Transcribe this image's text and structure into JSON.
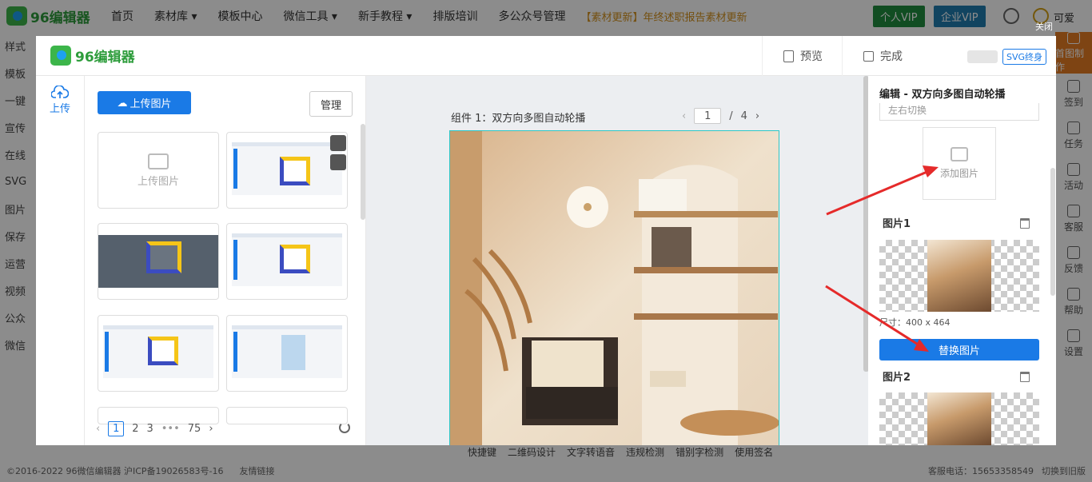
{
  "app": {
    "logo_text": "96编辑器",
    "nav": [
      "首页",
      "素材库 ▾",
      "模板中心",
      "微信工具 ▾",
      "新手教程 ▾",
      "排版培训",
      "多公众号管理"
    ],
    "notice": "【素材更新】年终述职报告素材更新",
    "vip_personal": "个人VIP",
    "vip_enterprise": "企业VIP",
    "user_name": "可爱",
    "close_label": "关闭"
  },
  "left_sidebar": [
    "样式",
    "模板",
    "一键",
    "宣传",
    "在线",
    "SVG",
    "图片",
    "保存",
    "运营",
    "视频",
    "公众",
    "微信"
  ],
  "right_sidebar": [
    {
      "label": "首图制作",
      "active": true
    },
    {
      "label": "签到",
      "active": false
    },
    {
      "label": "任务",
      "active": false
    },
    {
      "label": "活动",
      "active": false
    },
    {
      "label": "客服",
      "active": false
    },
    {
      "label": "反馈",
      "active": false
    },
    {
      "label": "帮助",
      "active": false
    },
    {
      "label": "设置",
      "active": false
    }
  ],
  "bottom_tools": [
    "快捷键",
    "二维码设计",
    "文字转语音",
    "违规检测",
    "错别字检测",
    "使用签名"
  ],
  "footer": {
    "copyright": "©2016-2022 96微信编辑器 沪ICP备19026583号-16",
    "friend_link": "友情链接",
    "phone": "客服电话：15653358549",
    "old_version": "切换到旧版"
  },
  "modal": {
    "logo_text": "96编辑器",
    "preview_label": "预览",
    "done_label": "完成",
    "svg_badge": "SVG终身",
    "side_tab_label": "上传",
    "upload_button": "上传图片",
    "manage_button": "管理",
    "upload_placeholder": "上传图片",
    "pagination": {
      "current": "1",
      "pages": [
        "2",
        "3",
        "•••",
        "75"
      ]
    },
    "canvas": {
      "component_title": "组件 1：双方向多图自动轮播",
      "page_current": "1",
      "page_sep": "/",
      "page_total": "4"
    },
    "editor": {
      "title": "编辑 - 双方向多图自动轮播",
      "select_value": "左右切换",
      "add_image": "添加图片",
      "image1_label": "图片1",
      "dimensions": "尺寸：400 x 464",
      "replace_button": "替换图片",
      "image2_label": "图片2"
    }
  },
  "colors": {
    "primary": "#1a7ae6",
    "brand_green": "#3cb54a",
    "accent_orange": "#e57c24",
    "annotation_red": "#e52a2a"
  }
}
